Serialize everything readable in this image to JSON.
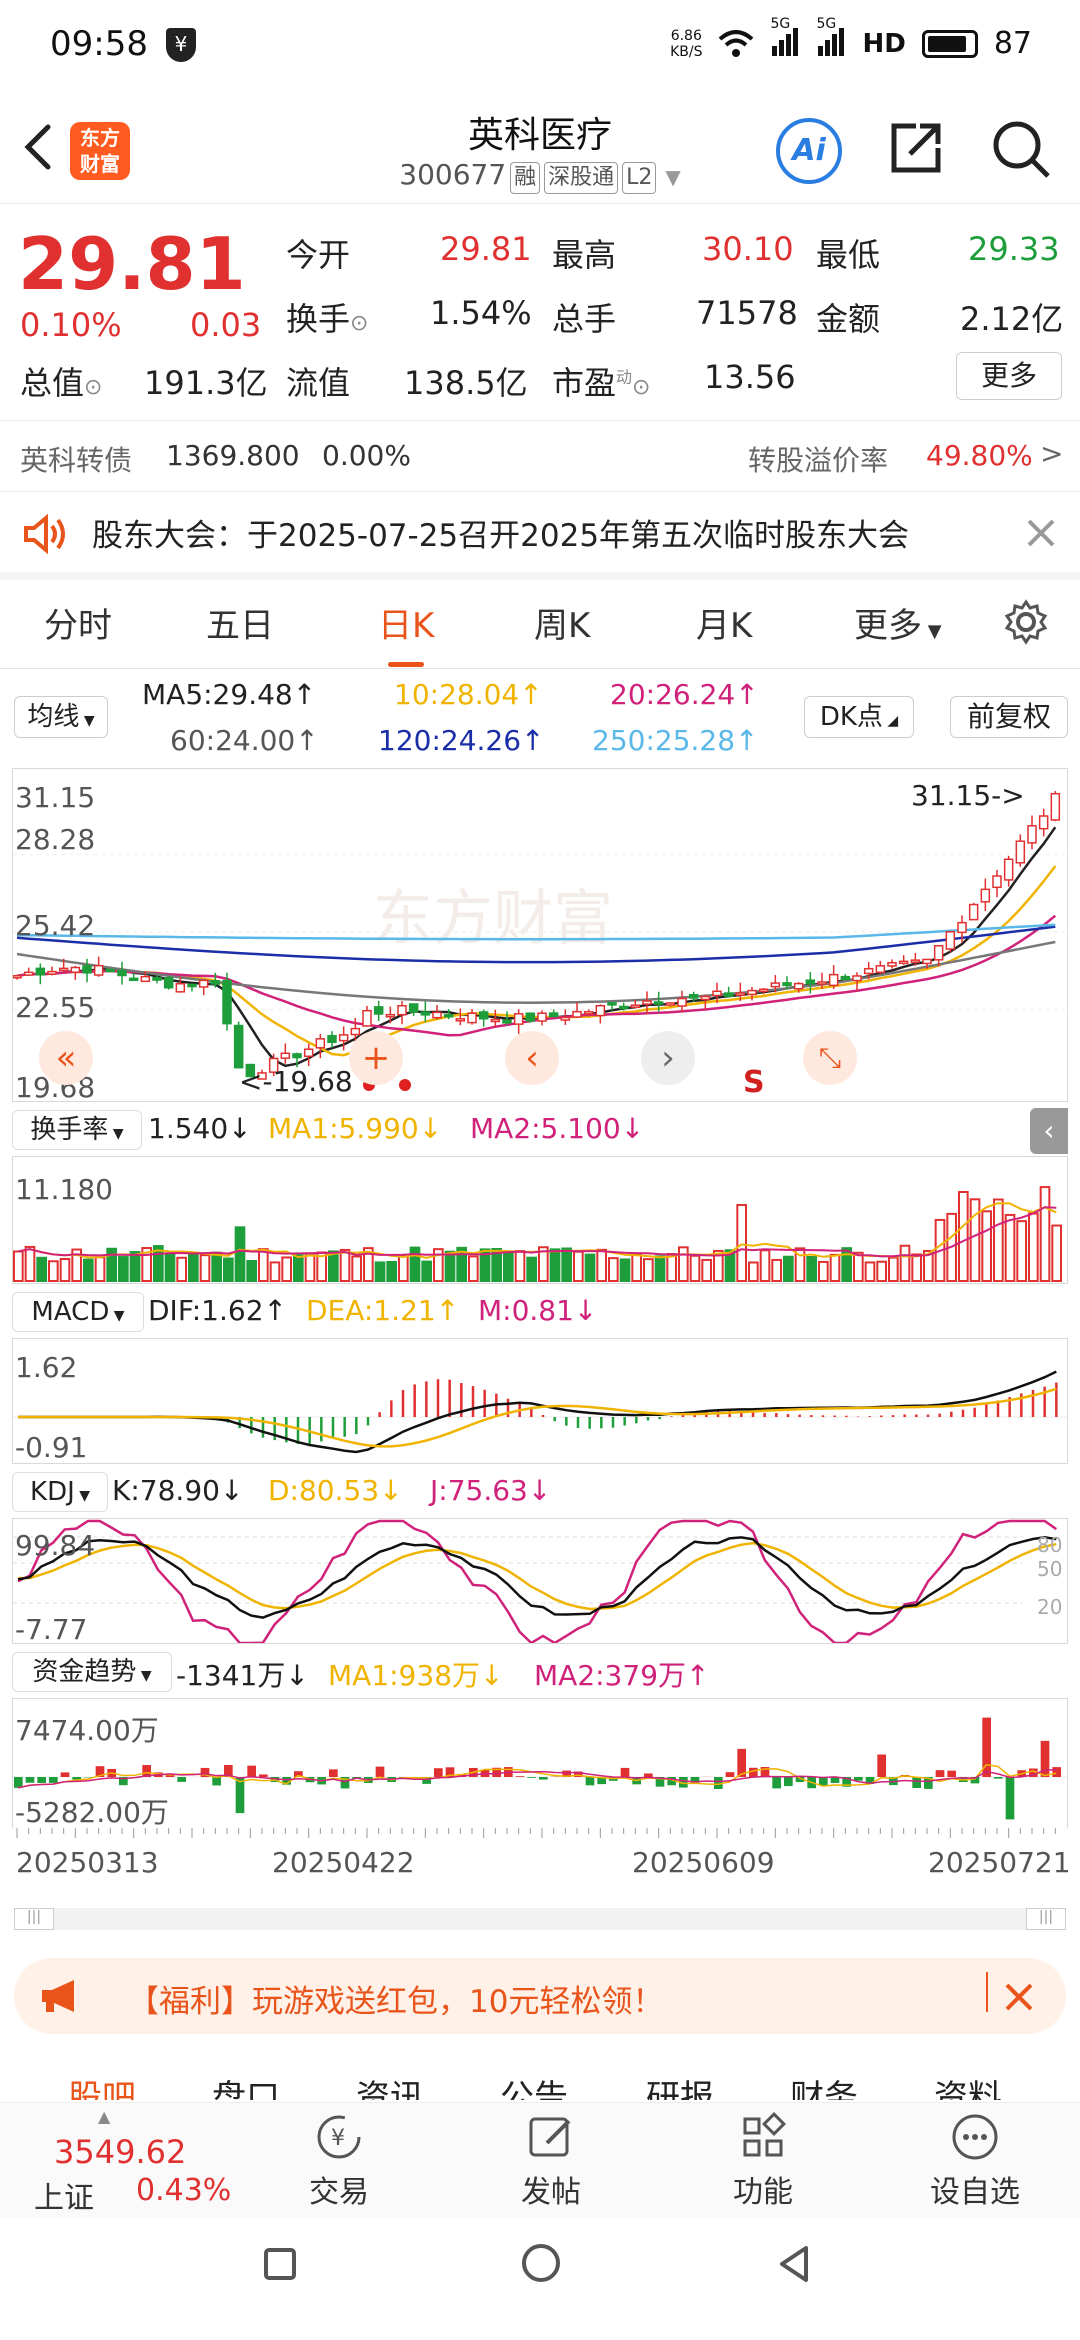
{
  "status": {
    "time": "09:58",
    "net_speed": "6.86\nKB/S",
    "signal1": "5G",
    "signal2": "5G",
    "hd": "HD",
    "battery": "87",
    "battery_level": 0.87
  },
  "header": {
    "logo_text": "东方\n财富",
    "title": "英科医疗",
    "code": "300677",
    "tags": [
      "融",
      "深股通",
      "L2"
    ],
    "ai_label": "Ai"
  },
  "quote": {
    "price": "29.81",
    "change_pct": "0.10%",
    "change": "0.03",
    "open_label": "今开",
    "open": "29.81",
    "high_label": "最高",
    "high": "30.10",
    "low_label": "最低",
    "low": "29.33",
    "turnover_label": "换手",
    "turnover": "1.54%",
    "volume_label": "总手",
    "volume": "71578",
    "amount_label": "金额",
    "amount": "2.12亿",
    "mktcap_label": "总值",
    "mktcap": "191.3亿",
    "float_label": "流值",
    "float": "138.5亿",
    "pe_label": "市盈",
    "pe_sup": "动",
    "pe": "13.56",
    "more_button": "更多"
  },
  "bond": {
    "name": "英科转债",
    "price": "1369.800",
    "pct": "0.00%",
    "premium_label": "转股溢价率",
    "premium": "49.80%",
    "arrow": ">"
  },
  "notice": {
    "text": "股东大会：于2025-07-25召开2025年第五次临时股东大会"
  },
  "tabs": [
    "分时",
    "五日",
    "日K",
    "周K",
    "月K",
    "更多"
  ],
  "ma": {
    "selector": "均线",
    "ma5": "MA5:29.48↑",
    "ma10": "10:28.04↑",
    "ma20": "20:26.24↑",
    "ma60": "60:24.00↑",
    "ma120": "120:24.26↑",
    "ma250": "250:25.28↑",
    "dk_button": "DK点",
    "adjust_button": "前复权"
  },
  "kchart": {
    "y_top": "31.15",
    "y_2": "28.28",
    "y_3": "25.42",
    "y_4": "22.55",
    "y_bottom": "19.68",
    "max_marker": "31.15->",
    "min_marker": "<-19.68",
    "s_marker": "S",
    "watermark": "东方财富"
  },
  "turnover": {
    "selector": "换手率",
    "value": "1.540↓",
    "ma1": "MA1:5.990↓",
    "ma2": "MA2:5.100↓",
    "y_top": "11.180"
  },
  "macd": {
    "selector": "MACD",
    "dif": "DIF:1.62↑",
    "dea": "DEA:1.21↑",
    "m": "M:0.81↓",
    "y_top": "1.62",
    "y_bottom": "-0.91"
  },
  "kdj": {
    "selector": "KDJ",
    "k": "K:78.90↓",
    "d": "D:80.53↓",
    "j": "J:75.63↓",
    "y_top": "99.84",
    "y_bottom": "-7.77",
    "l80": "80",
    "l50": "50",
    "l20": "20"
  },
  "fund": {
    "selector": "资金趋势",
    "value": "-1341万↓",
    "ma1": "MA1:938万↓",
    "ma2": "MA2:379万↑",
    "y_top": "7474.00万",
    "y_bottom": "-5282.00万"
  },
  "dates": [
    "20250313",
    "20250422",
    "20250609",
    "20250721"
  ],
  "banner": {
    "text": "【福利】玩游戏送红包，10元轻松领！"
  },
  "bottom_tabs": [
    "股吧",
    "盘口",
    "资讯",
    "公告",
    "研报",
    "财务",
    "资料"
  ],
  "tabbar": {
    "index_value": "3549.62",
    "index_name": "上证",
    "index_pct": "0.43%",
    "items": [
      "交易",
      "发帖",
      "功能",
      "设自选"
    ]
  }
}
